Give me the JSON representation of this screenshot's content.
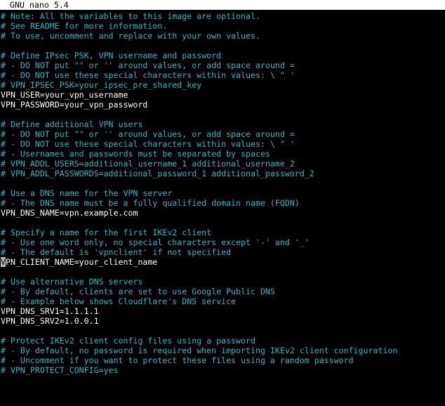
{
  "window": {
    "title": "GNU nano 5.4"
  },
  "colors": {
    "background": "#000000",
    "comment": "#2ab7c6",
    "code": "#ffffff",
    "titlebar": "#ffffff"
  },
  "editor": {
    "lines": [
      "# Note: All the variables to this image are optional.",
      "# See README for more information.",
      "# To use, uncomment and replace with your own values.",
      "",
      "# Define IPsec PSK, VPN username and password",
      "# - DO NOT put \"\" or '' around values, or add space around =",
      "# - DO NOT use these special characters within values: \\ \" '",
      "# VPN_IPSEC_PSK=your_ipsec_pre_shared_key",
      "VPN_USER=your_vpn_username",
      "VPN_PASSWORD=your_vpn_password",
      "",
      "# Define additional VPN users",
      "# - DO NOT put \"\" or '' around values, or add space around =",
      "# - DO NOT use these special characters within values: \\ \" '",
      "# - Usernames and passwords must be separated by spaces",
      "# VPN_ADDL_USERS=additional_username_1 additional_username_2",
      "# VPN_ADDL_PASSWORDS=additional_password_1 additional_password_2",
      "",
      "# Use a DNS name for the VPN server",
      "# - The DNS name must be a fully qualified domain name (FQDN)",
      "VPN_DNS_NAME=vpn.example.com",
      "",
      "# Specify a name for the first IKEv2 client",
      "# - Use one word only, no special characters except '-' and '_'",
      "# - The default is 'vpnclient' if not specified",
      "VPN_CLIENT_NAME=your_client_name",
      "",
      "# Use alternative DNS servers",
      "# - By default, clients are set to use Google Public DNS",
      "# - Example below shows Cloudflare's DNS service",
      "VPN_DNS_SRV1=1.1.1.1",
      "VPN_DNS_SRV2=1.0.0.1",
      "",
      "# Protect IKEv2 client config files using a password",
      "# - By default, no password is required when importing IKEv2 client configuration",
      "# - Uncomment if you want to protect these files using a random password",
      "# VPN_PROTECT_CONFIG=yes"
    ]
  }
}
